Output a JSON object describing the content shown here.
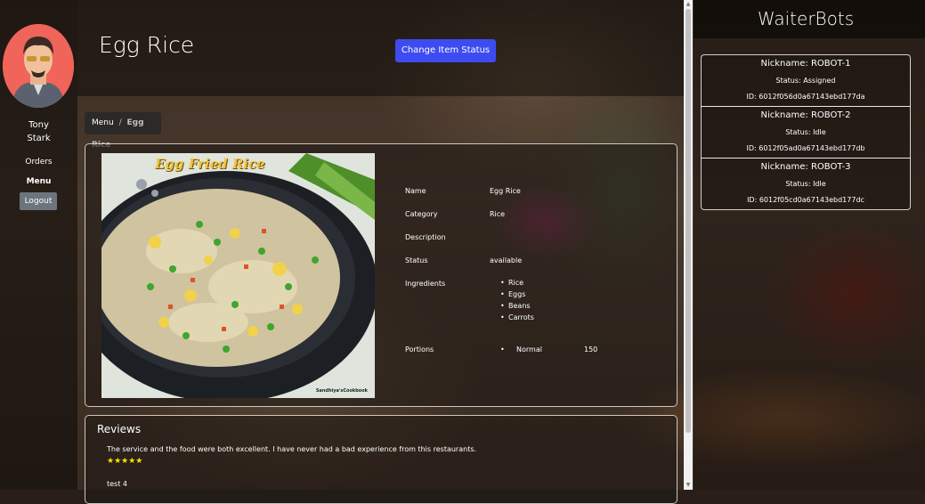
{
  "user": {
    "first_name": "Tony",
    "last_name": "Stark"
  },
  "nav": {
    "orders": "Orders",
    "menu": "Menu",
    "logout": "Logout"
  },
  "header": {
    "title": "Egg Rice",
    "change_status": "Change Item Status"
  },
  "breadcrumb": {
    "root": "Menu",
    "separator": "/",
    "current": "Egg Rice"
  },
  "item": {
    "image_title": "Egg Fried Rice",
    "image_credit": "Sandhiya'sCookbook",
    "labels": {
      "name": "Name",
      "category": "Category",
      "description": "Description",
      "status": "Status",
      "ingredients": "Ingredients",
      "portions": "Portions"
    },
    "name": "Egg Rice",
    "category": "Rice",
    "description": "",
    "status": "available",
    "ingredients": [
      "Rice",
      "Eggs",
      "Beans",
      "Carrots"
    ],
    "portions": [
      {
        "name": "Normal",
        "price": "150"
      }
    ]
  },
  "reviews": {
    "title": "Reviews",
    "items": [
      {
        "text": "The service and the food were both excellent. I have never had a bad experience from this restaurants.",
        "stars": "★★★★★"
      },
      {
        "text": "test 4"
      }
    ]
  },
  "waiterbots": {
    "title": "WaiterBots",
    "bots": [
      {
        "nickname": "Nickname: ROBOT-1",
        "status": "Status: Assigned",
        "id": "ID: 6012f056d0a67143ebd177da"
      },
      {
        "nickname": "Nickname: ROBOT-2",
        "status": "Status: Idle",
        "id": "ID: 6012f05ad0a67143ebd177db"
      },
      {
        "nickname": "Nickname: ROBOT-3",
        "status": "Status: Idle",
        "id": "ID: 6012f05cd0a67143ebd177dc"
      }
    ]
  },
  "scrollbar": {
    "up_icon": "▲",
    "down_icon": "▼"
  },
  "colors": {
    "primary_button": "#3d4cf0",
    "logout_button": "#6c757d",
    "stars": "#f5e400",
    "avatar_bg": "#f0645a"
  }
}
